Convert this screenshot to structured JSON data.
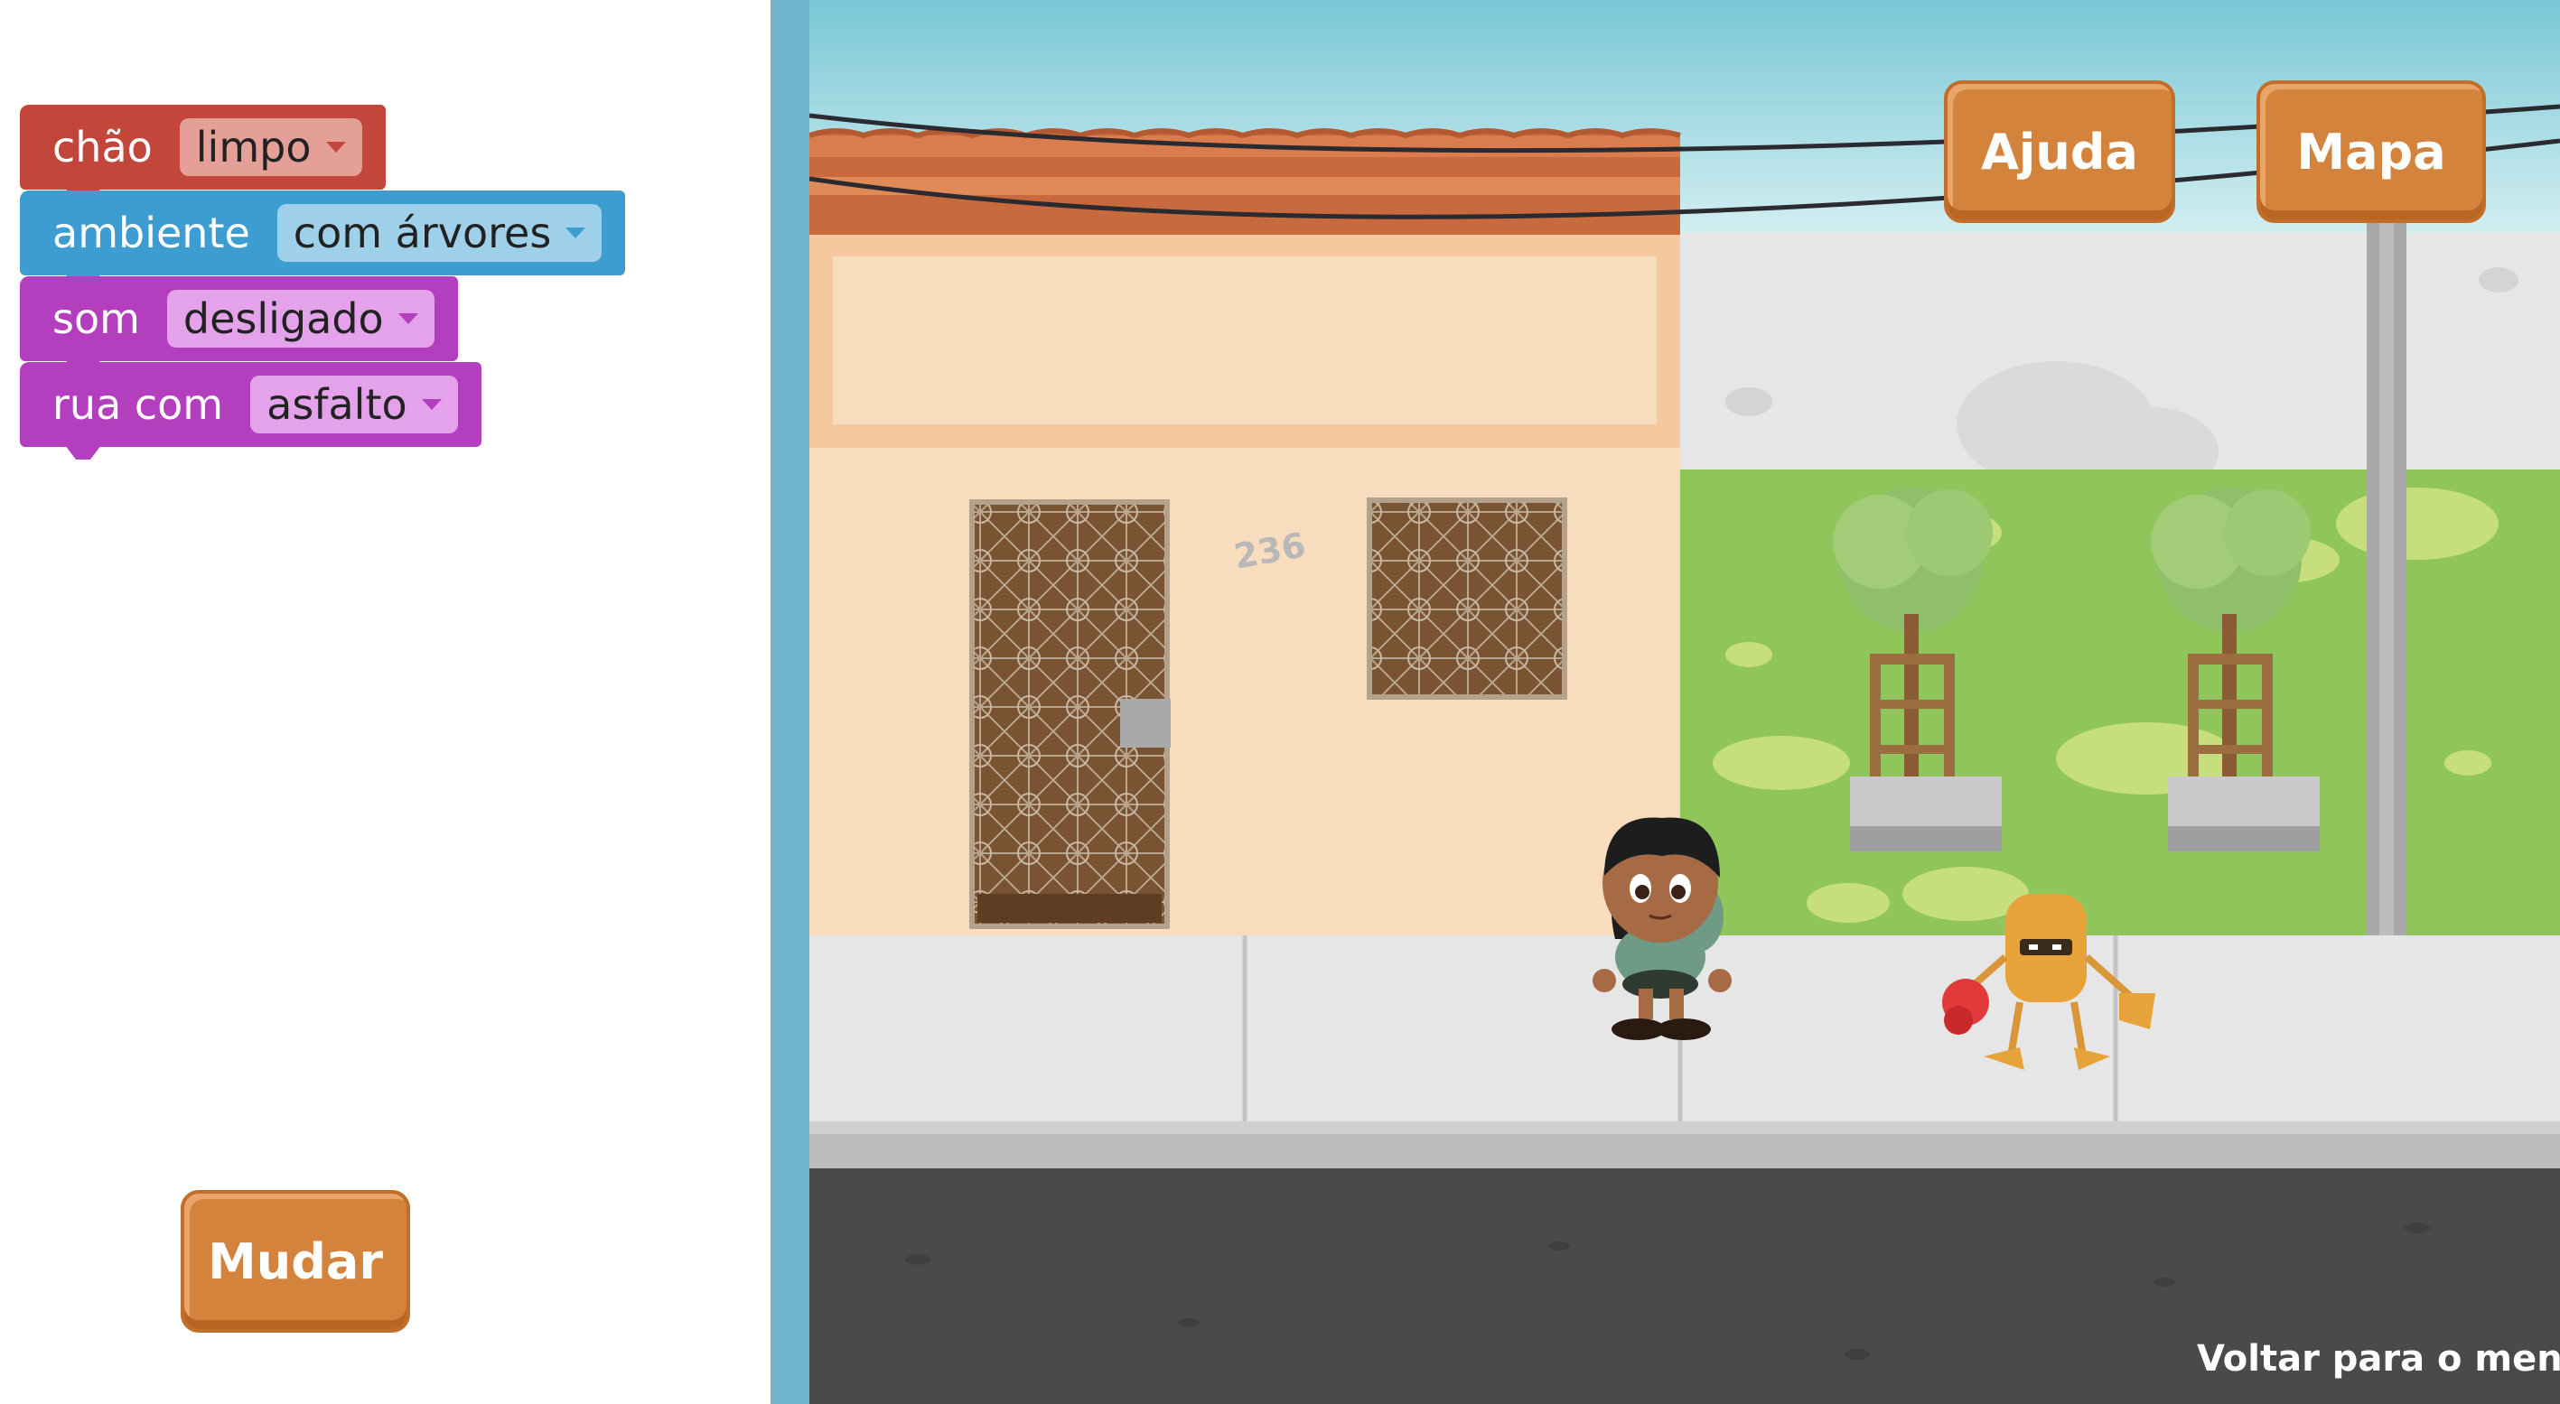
{
  "blocks": [
    {
      "label": "chão",
      "value": "limpo",
      "color": "#c2473a",
      "dd_color": "#e49f97",
      "caret_color": "#c2473a"
    },
    {
      "label": "ambiente",
      "value": "com árvores",
      "color": "#3e9dd0",
      "dd_color": "#9fd0ea",
      "caret_color": "#3e9dd0"
    },
    {
      "label": "som",
      "value": "desligado",
      "color": "#b43fbe",
      "dd_color": "#e3a2ea",
      "caret_color": "#b43fbe"
    },
    {
      "label": "rua com",
      "value": "asfalto",
      "color": "#b43fbe",
      "dd_color": "#e3a2ea",
      "caret_color": "#b43fbe"
    }
  ],
  "buttons": {
    "change": "Mudar",
    "help": "Ajuda",
    "map": "Mapa"
  },
  "scene": {
    "house_number": "236",
    "back_link": "Voltar para o menu"
  },
  "colors": {
    "button": "#d4833c",
    "divider": "#6fb4cb",
    "sky": "#a9dce6",
    "wall": "#f8dcbe",
    "grass": "#8fc55a",
    "asphalt": "#4a4a4a"
  }
}
